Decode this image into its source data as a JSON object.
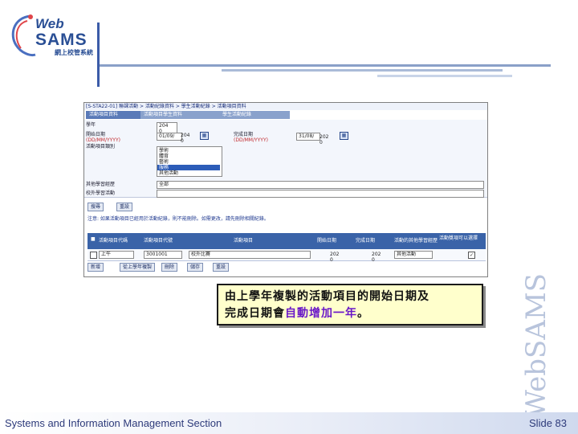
{
  "logo": {
    "web": "Web",
    "sams": "SAMS",
    "subtitle": "網上校管系統"
  },
  "watermark": "WebSAMS",
  "panel": {
    "breadcrumb": "[S-STA22-01] 聯課活動 > 活動紀錄資料 > 學生活動紀錄 > 活動項目資料",
    "tabs": [
      "活動項目資料",
      "活動項目學生資料",
      "學生活動紀錄"
    ],
    "labels": {
      "year": "學年",
      "start_date": "開始日期",
      "start_fmt": "(DD/MM/YYYY)",
      "category": "活動項目類別",
      "end_date": "完成日期",
      "end_fmt": "(DD/MM/YYYY)",
      "ole": "其他學習經歷",
      "school": "校外學習活動"
    },
    "year_value": "204\n0",
    "start_value": "01/09/",
    "start_year": "204\n0",
    "end_value": "31/08/",
    "end_year": "202\n0",
    "category_items": [
      "學術",
      "體育",
      "藝術",
      "服務",
      "其他活動",
      "學校活動"
    ],
    "selected_index": 3,
    "ole_value": "全部",
    "buttons_top": [
      "搜尋",
      "重設"
    ],
    "info_text": "注意: 如果活動項目已經用於活動紀錄，則不能刪除。如需更改，請先刪除相關紀錄。",
    "table_headers": [
      "活動項目代碼",
      "活動項目代號",
      "活動項目",
      "開始日期",
      "完成日期",
      "活動的其他學習經歷",
      "活動獎項",
      "可以選擇"
    ],
    "row": {
      "code": "上午",
      "id": "3001001",
      "name": "校外比賽",
      "start": "202\n0",
      "end": "202\n0",
      "ole": "其他活動",
      "checked": "✓"
    },
    "buttons_bottom": [
      "新增",
      "從上學年複製",
      "刪除",
      "儲存",
      "重設"
    ]
  },
  "callout": {
    "line1": "由上學年複製的活動項目的開始日期及",
    "line2_a": "完成日期會",
    "line2_hl": "自動增加一年",
    "line2_b": "。"
  },
  "footer": {
    "left": "Systems and Information Management Section",
    "right": "Slide 83"
  }
}
